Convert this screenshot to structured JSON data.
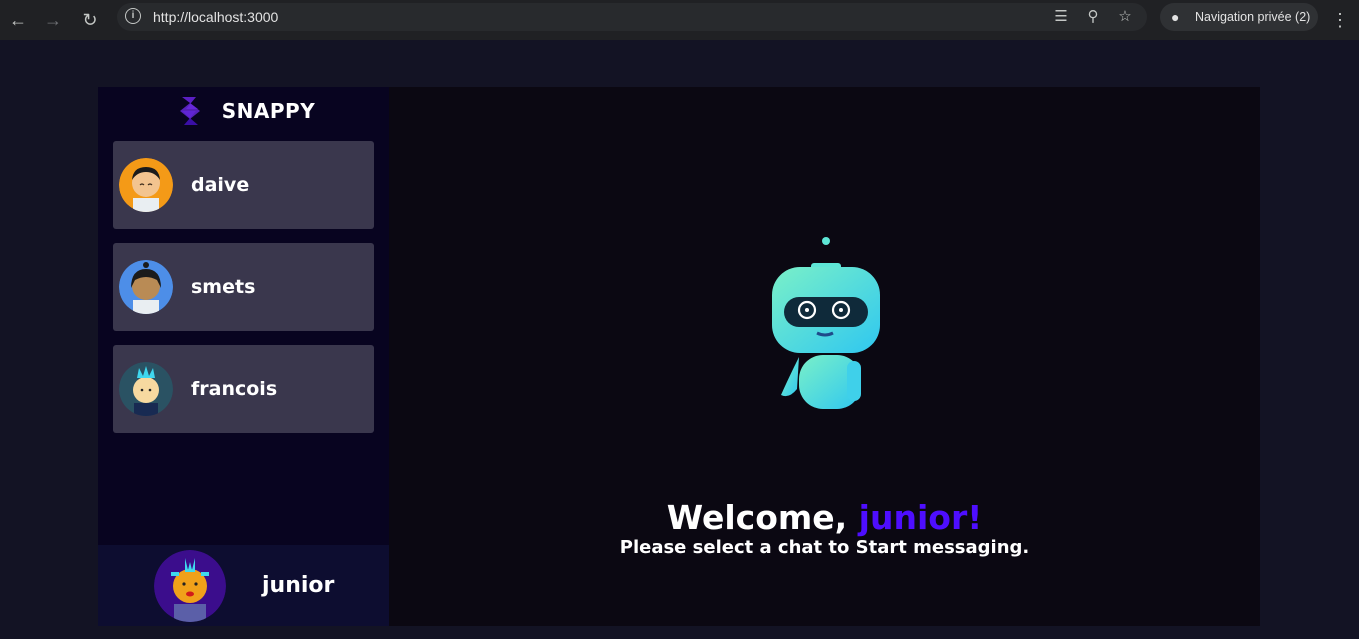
{
  "browser": {
    "url": "http://localhost:3000",
    "profile_label": "Navigation privée (2)",
    "icons": [
      "back-icon",
      "forward-icon",
      "reload-icon",
      "info-icon",
      "translate-icon",
      "zoom-icon",
      "star-icon",
      "incognito-icon",
      "menu-icon"
    ]
  },
  "app": {
    "brand_name": "SNAPPY",
    "contacts": [
      {
        "name": "daive"
      },
      {
        "name": "smets"
      },
      {
        "name": "francois"
      }
    ],
    "current_user": {
      "name": "junior"
    },
    "welcome": {
      "greeting": "Welcome, ",
      "username": "junior!",
      "subtitle": "Please select a chat to Start messaging."
    },
    "colors": {
      "accent": "#4e0eff",
      "sidebar": "#080420",
      "contact_card": "#ffffff34",
      "background": "#131324"
    }
  }
}
